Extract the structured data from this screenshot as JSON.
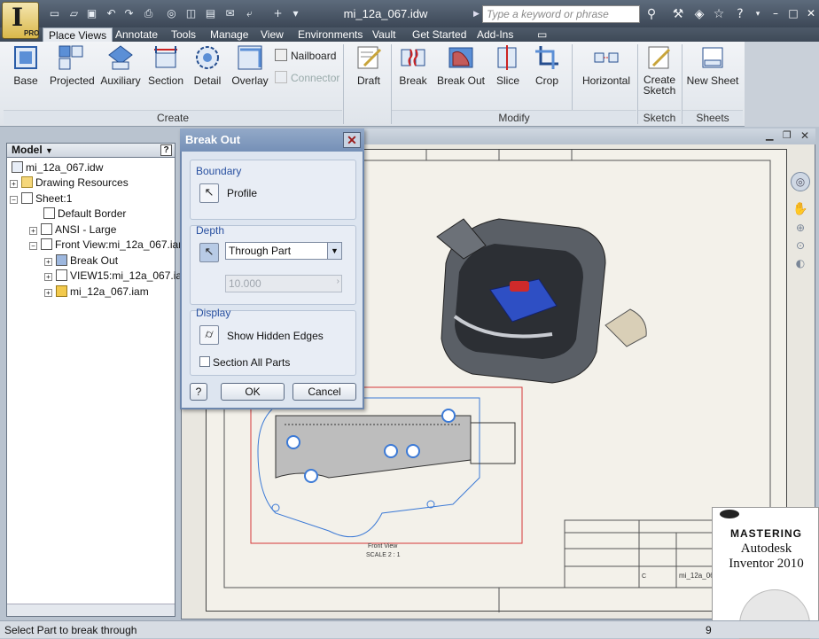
{
  "app": {
    "logo_letter": "I",
    "edition": "PRO",
    "document_title": "mi_12a_067.idw"
  },
  "search": {
    "placeholder": "Type a keyword or phrase"
  },
  "tabs": [
    "Place Views",
    "Annotate",
    "Tools",
    "Manage",
    "View",
    "Environments",
    "Vault",
    "Get Started",
    "Add-Ins"
  ],
  "ribbon": {
    "create": [
      "Base",
      "Projected",
      "Auxiliary",
      "Section",
      "Detail",
      "Overlay"
    ],
    "create_small": [
      "Nailboard",
      "Connector"
    ],
    "draft": "Draft",
    "modify": [
      "Break",
      "Break Out",
      "Slice",
      "Crop"
    ],
    "horizontal": "Horizontal",
    "sketch": [
      "Create",
      "Sketch"
    ],
    "sheets": "New Sheet",
    "group_create": "Create",
    "group_modify": "Modify",
    "group_sketch": "Sketch",
    "group_sheets": "Sheets"
  },
  "browser": {
    "title": "Model",
    "items": [
      "mi_12a_067.idw",
      "Drawing Resources",
      "Sheet:1",
      "Default Border",
      "ANSI - Large",
      "Front View:mi_12a_067.iam",
      "Break Out",
      "VIEW15:mi_12a_067.iam",
      "mi_12a_067.iam"
    ]
  },
  "dialog": {
    "title": "Break Out",
    "boundary_label": "Boundary",
    "profile_label": "Profile",
    "depth_label": "Depth",
    "depth_value": "Through Part",
    "depth_distance": "10.000",
    "display_label": "Display",
    "hidden_edges": "Show Hidden Edges",
    "section_all": "Section All Parts",
    "ok": "OK",
    "cancel": "Cancel",
    "help": "?"
  },
  "drawing": {
    "view_label": "Front View",
    "scale": "SCALE 2 : 1",
    "title_block_name": "mi_12a_06",
    "rev": "C"
  },
  "book": {
    "line1": "MASTERING",
    "line2": "Autodesk",
    "line3": "Inventor 2010"
  },
  "status": {
    "text": "Select Part to break through",
    "right": "9"
  }
}
